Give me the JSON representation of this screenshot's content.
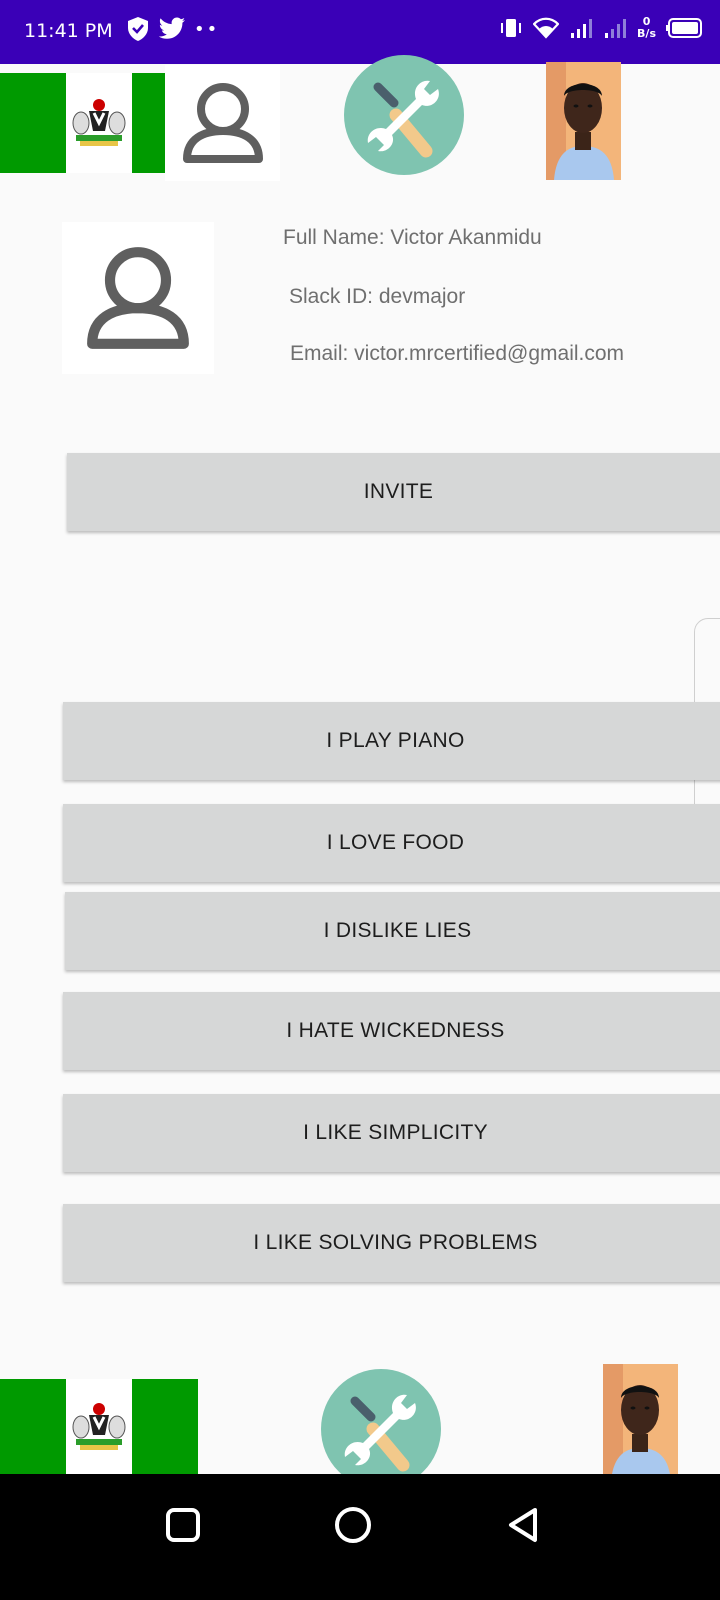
{
  "status_bar": {
    "time": "11:41 PM",
    "dots": "••",
    "net_speed_value": "0",
    "net_speed_unit": "B/s",
    "background": "#3a00b7"
  },
  "icons": {
    "flag": "nigeria-flag",
    "profile": "person-icon",
    "tools": "tools-icon",
    "photo": "profile-photo"
  },
  "profile": {
    "full_name": "Full Name: Victor Akanmidu",
    "slack_id": "Slack ID: devmajor",
    "email": "Email: victor.mrcertified@gmail.com"
  },
  "buttons": {
    "invite": "INVITE",
    "piano": "I PLAY PIANO",
    "food": "I LOVE FOOD",
    "lies": "I DISLIKE LIES",
    "wickedness": "I HATE WICKEDNESS",
    "simplicity": "I LIKE SIMPLICITY",
    "problems": "I LIKE SOLVING PROBLEMS"
  },
  "colors": {
    "flag_green": "#009a00",
    "tools_bg": "#7fc4b0",
    "button_bg": "#d6d7d7"
  }
}
